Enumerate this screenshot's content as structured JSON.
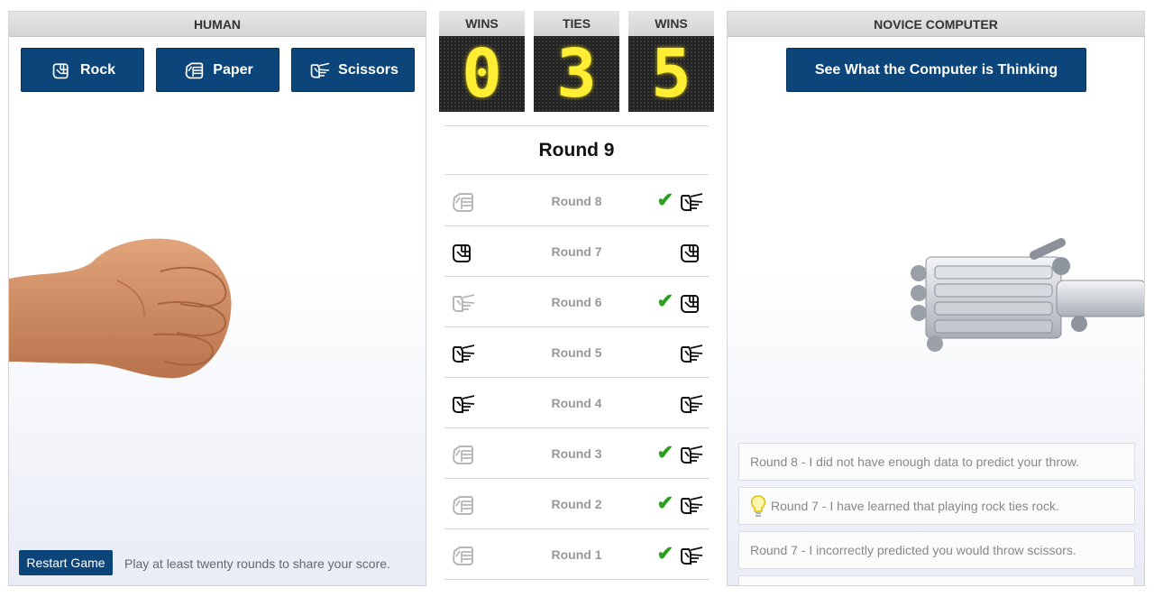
{
  "human_panel": {
    "title": "HUMAN",
    "buttons": {
      "rock": "Rock",
      "paper": "Paper",
      "scissors": "Scissors"
    },
    "restart_label": "Restart Game",
    "hint": "Play at least twenty rounds to share your score."
  },
  "scoreboard": {
    "human_wins_label": "WINS",
    "ties_label": "TIES",
    "computer_wins_label": "WINS",
    "human_wins": "0",
    "ties": "3",
    "computer_wins": "5"
  },
  "current_round": "Round 9",
  "history": [
    {
      "label": "Round 8",
      "human": "paper",
      "computer": "scissors",
      "winner": "computer"
    },
    {
      "label": "Round 7",
      "human": "rock",
      "computer": "rock",
      "winner": "tie"
    },
    {
      "label": "Round 6",
      "human": "scissors",
      "computer": "rock",
      "winner": "computer"
    },
    {
      "label": "Round 5",
      "human": "scissors",
      "computer": "scissors",
      "winner": "tie"
    },
    {
      "label": "Round 4",
      "human": "scissors",
      "computer": "scissors",
      "winner": "tie"
    },
    {
      "label": "Round 3",
      "human": "paper",
      "computer": "scissors",
      "winner": "computer"
    },
    {
      "label": "Round 2",
      "human": "paper",
      "computer": "scissors",
      "winner": "computer"
    },
    {
      "label": "Round 1",
      "human": "paper",
      "computer": "scissors",
      "winner": "computer"
    }
  ],
  "computer_panel": {
    "title": "NOVICE COMPUTER",
    "think_button": "See What the Computer is Thinking",
    "thoughts": [
      {
        "text": "Round 8 - I did not have enough data to predict your throw.",
        "bulb": false
      },
      {
        "text": "Round 7 - I have learned that playing rock ties rock.",
        "bulb": true
      },
      {
        "text": "Round 7 - I incorrectly predicted you would throw scissors.",
        "bulb": false
      }
    ]
  },
  "colors": {
    "button_blue": "#0c4579",
    "check_green": "#2aa01c",
    "led_yellow": "#ffee33"
  }
}
